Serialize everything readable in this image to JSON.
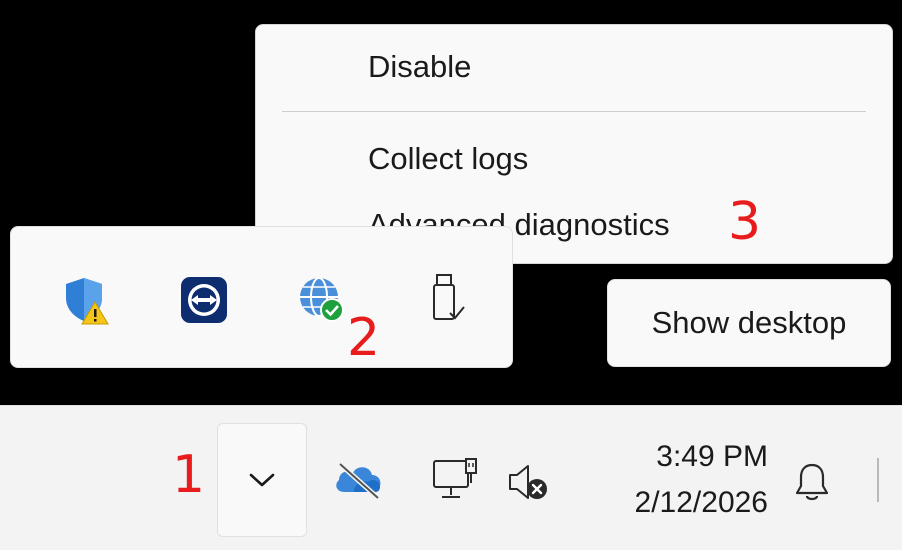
{
  "context_menu": {
    "items": [
      {
        "label": "Disable"
      },
      {
        "label": "Collect logs"
      },
      {
        "label": "Advanced diagnostics"
      }
    ]
  },
  "tooltip": {
    "show_desktop": "Show desktop"
  },
  "tray_overflow": {
    "icons": [
      "security-warning-icon",
      "teamviewer-icon",
      "network-globe-check-icon",
      "usb-drive-icon"
    ]
  },
  "taskbar": {
    "icons": [
      "chevron-down-icon",
      "onedrive-offline-icon",
      "network-ethernet-icon",
      "speaker-muted-icon",
      "bell-icon"
    ],
    "clock": {
      "time": "3:49 PM",
      "date": "2/12/2026"
    }
  },
  "annotations": {
    "step1": "1",
    "step2": "2",
    "step3": "3"
  },
  "colors": {
    "annotation": "#e81c1c",
    "shield_blue": "#2f7fd6",
    "warning_yellow": "#f5c518",
    "teamviewer_navy": "#0e2d6e",
    "check_green": "#1ea03c"
  }
}
